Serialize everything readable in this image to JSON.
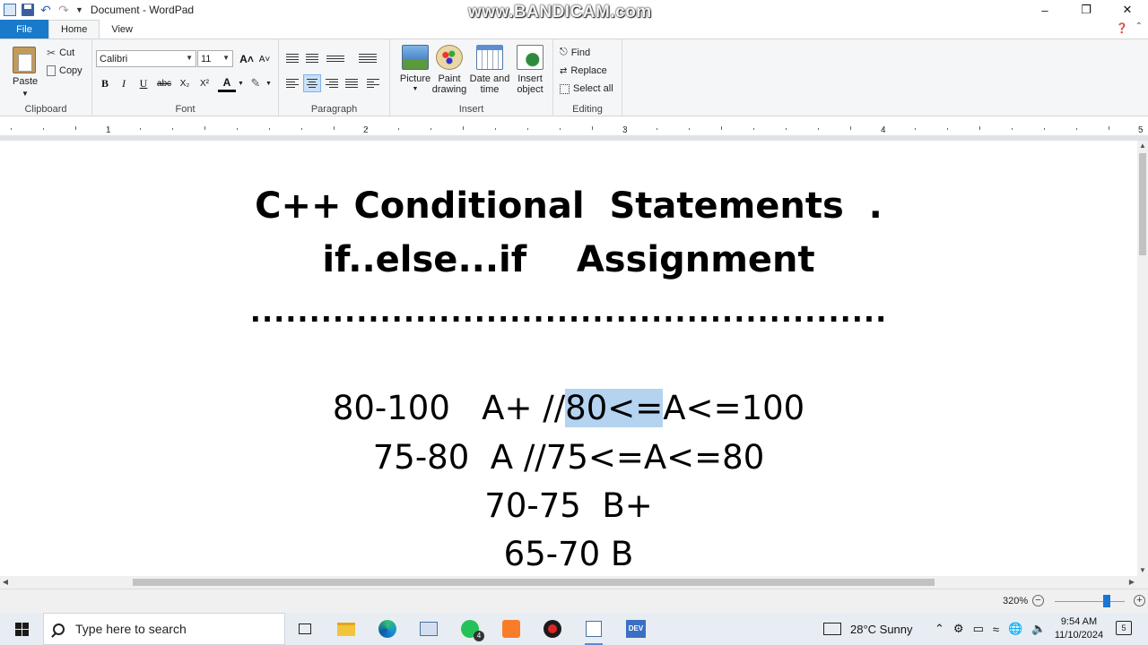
{
  "window": {
    "title": "Document - WordPad",
    "watermark": "www.BANDICAM.com",
    "minimize": "–",
    "maximize": "❐",
    "close": "✕"
  },
  "tabs": {
    "file": "File",
    "home": "Home",
    "view": "View"
  },
  "ribbon": {
    "clipboard": {
      "label": "Clipboard",
      "paste": "Paste",
      "cut": "Cut",
      "copy": "Copy"
    },
    "font": {
      "label": "Font",
      "family": "Calibri",
      "size": "11",
      "bold": "B",
      "italic": "I",
      "underline": "U",
      "strike": "abc",
      "subscript": "X₂",
      "superscript": "X²",
      "color": "A"
    },
    "paragraph": {
      "label": "Paragraph"
    },
    "insert": {
      "label": "Insert",
      "picture": "Picture",
      "paint_1": "Paint",
      "paint_2": "drawing",
      "datetime_1": "Date and",
      "datetime_2": "time",
      "object_1": "Insert",
      "object_2": "object"
    },
    "editing": {
      "label": "Editing",
      "find": "Find",
      "replace": "Replace",
      "select_all": "Select all"
    }
  },
  "ruler": {
    "numbers": [
      "1",
      "2",
      "3",
      "4",
      "5"
    ]
  },
  "document": {
    "title_line1": "C++ Conditional  Statements  .",
    "title_line2": "if..else...if    Assignment",
    "dots": "......................................................",
    "grade1_pre": "80-100   A+ //",
    "grade1_sel": "80<=",
    "grade1_post": "A<=100",
    "grade2": "75-80  A //75<=A<=80",
    "grade3": "70-75  B+",
    "grade4": "65-70 B"
  },
  "status": {
    "zoom": "320%"
  },
  "taskbar": {
    "search_placeholder": "Type here to search",
    "whatsapp_badge": "4",
    "weather": "28°C  Sunny",
    "time": "9:54 AM",
    "date": "11/10/2024",
    "notification_count": "5"
  },
  "colors": {
    "file_tab": "#1979ca",
    "selection": "#b4d3f0",
    "zoom_thumb": "#1c75d2"
  }
}
